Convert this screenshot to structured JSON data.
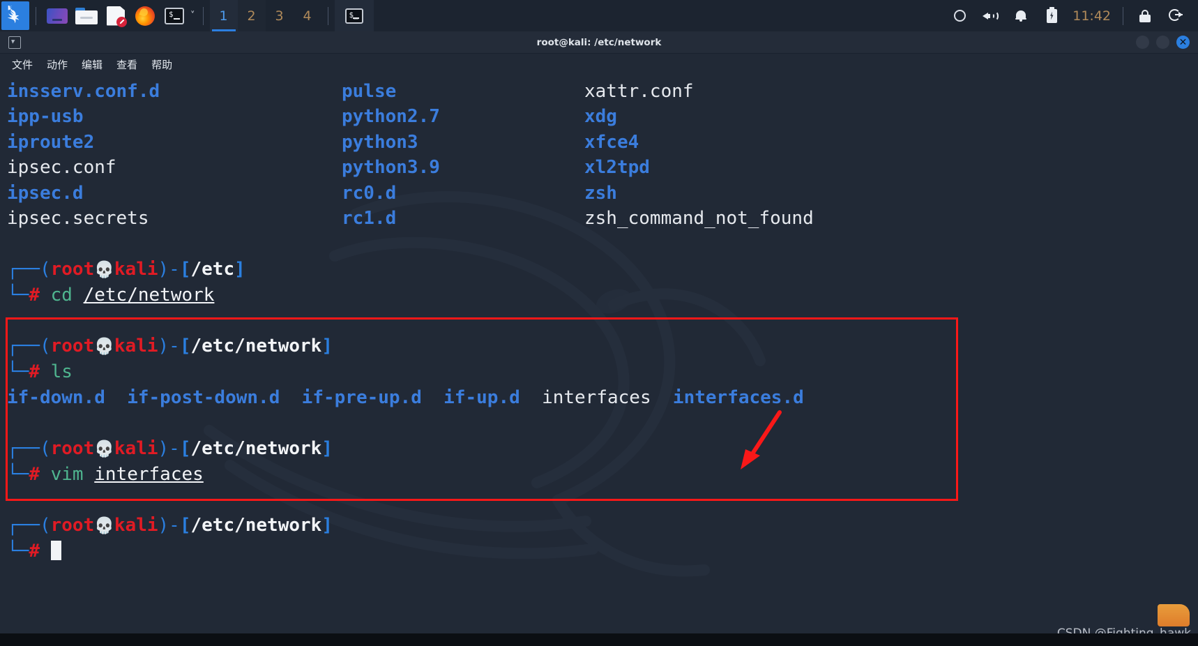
{
  "panel": {
    "launchers": [
      {
        "name": "kali-menu-icon",
        "label": "Kali Menu"
      },
      {
        "name": "display-settings-icon",
        "label": "Display"
      },
      {
        "name": "file-manager-icon",
        "label": "Files"
      },
      {
        "name": "text-editor-icon",
        "label": "Text Editor"
      },
      {
        "name": "firefox-icon",
        "label": "Firefox"
      },
      {
        "name": "terminal-icon",
        "label": "Terminal"
      }
    ],
    "dropdown_caret": "˅",
    "workspaces": [
      "1",
      "2",
      "3",
      "4"
    ],
    "active_workspace": "1",
    "task_button": "terminal-window-icon",
    "tray": [
      {
        "name": "loading-ring-icon"
      },
      {
        "name": "volume-icon"
      },
      {
        "name": "notification-bell-icon"
      },
      {
        "name": "battery-charging-icon"
      }
    ],
    "clock": "11:42",
    "lock_icon": "lock-icon",
    "logout_icon": "logout-icon"
  },
  "window": {
    "title": "root@kali: /etc/network",
    "icon": "terminal-cursor-icon",
    "controls": {
      "minimize": "",
      "maximize": "",
      "close": "✕"
    },
    "menu": [
      "文件",
      "动作",
      "编辑",
      "查看",
      "帮助"
    ]
  },
  "terminal": {
    "etc_listing": {
      "columns": [
        [
          {
            "text": "insserv.conf.d",
            "type": "dir"
          },
          {
            "text": "ipp-usb",
            "type": "dir"
          },
          {
            "text": "iproute2",
            "type": "dir"
          },
          {
            "text": "ipsec.conf",
            "type": "file"
          },
          {
            "text": "ipsec.d",
            "type": "dir"
          },
          {
            "text": "ipsec.secrets",
            "type": "file"
          }
        ],
        [
          {
            "text": "pulse",
            "type": "dir"
          },
          {
            "text": "python2.7",
            "type": "dir"
          },
          {
            "text": "python3",
            "type": "dir"
          },
          {
            "text": "python3.9",
            "type": "dir"
          },
          {
            "text": "rc0.d",
            "type": "dir"
          },
          {
            "text": "rc1.d",
            "type": "dir"
          }
        ],
        [
          {
            "text": "xattr.conf",
            "type": "file"
          },
          {
            "text": "xdg",
            "type": "dir"
          },
          {
            "text": "xfce4",
            "type": "dir"
          },
          {
            "text": "xl2tpd",
            "type": "dir"
          },
          {
            "text": "zsh",
            "type": "dir"
          },
          {
            "text": "zsh_command_not_found",
            "type": "file"
          }
        ]
      ]
    },
    "prompt": {
      "corner_top": "┌──",
      "corner_bottom": "└─",
      "open_paren": "(",
      "user": "root",
      "skull": "💀",
      "host": "kali",
      "close_paren": ")",
      "dash": "-",
      "open_bracket": "[",
      "close_bracket": "]",
      "hash": "#"
    },
    "blocks": [
      {
        "cwd": "/etc",
        "command_name": "cd",
        "command_arg": "/etc/network",
        "output": null
      },
      {
        "cwd": "/etc/network",
        "command_name": "ls",
        "command_arg": "",
        "output": [
          {
            "text": "if-down.d",
            "type": "dir"
          },
          {
            "text": "if-post-down.d",
            "type": "dir"
          },
          {
            "text": "if-pre-up.d",
            "type": "dir"
          },
          {
            "text": "if-up.d",
            "type": "dir"
          },
          {
            "text": "interfaces",
            "type": "file"
          },
          {
            "text": "interfaces.d",
            "type": "dir"
          }
        ]
      },
      {
        "cwd": "/etc/network",
        "command_name": "vim",
        "command_arg": "interfaces",
        "output": null
      },
      {
        "cwd": "/etc/network",
        "command_name": "",
        "command_arg": "",
        "output": null
      }
    ]
  },
  "annotations": {
    "highlight_box_color": "#fa1818",
    "arrow_color": "#fa1818",
    "arrow_target": "interfaces"
  },
  "watermark": {
    "text": "CSDN @Fighting_hawk"
  },
  "colors": {
    "terminal_bg": "#212936",
    "panel_bg": "#1c2430",
    "dir_blue": "#3b7ddd",
    "prompt_red": "#e01b24",
    "prompt_blue": "#2b7fe0",
    "command_green": "#4fb58f",
    "accent_blue": "#2b7fe0",
    "clock_gold": "#b08a5a"
  }
}
